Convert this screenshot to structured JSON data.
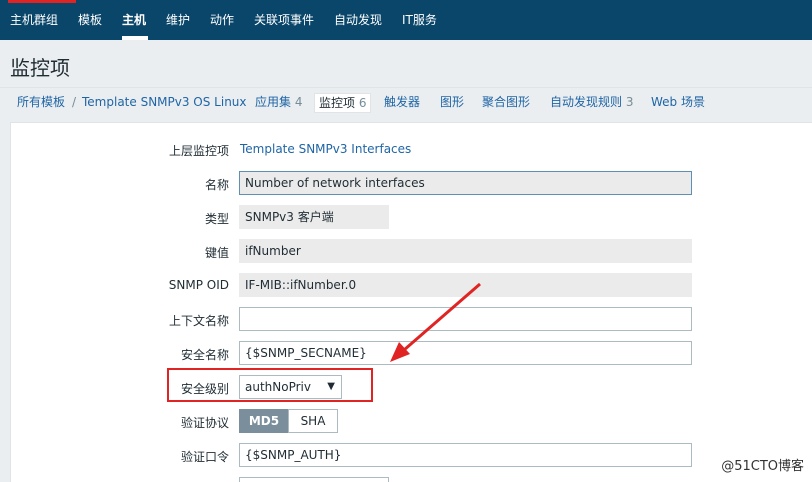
{
  "top_nav": [
    "主机群组",
    "模板",
    "主机",
    "维护",
    "动作",
    "关联项事件",
    "自动发现",
    "IT服务"
  ],
  "page_title": "监控项",
  "breadcrumb": {
    "all_templates": "所有模板",
    "separator": "/",
    "template": "Template SNMPv3 OS Linux",
    "tabs": [
      {
        "label": "应用集",
        "count": "4"
      },
      {
        "label": "监控项",
        "count": "6"
      },
      {
        "label": "触发器",
        "count": ""
      },
      {
        "label": "图形",
        "count": ""
      },
      {
        "label": "聚合图形",
        "count": ""
      },
      {
        "label": "自动发现规则",
        "count": "3"
      },
      {
        "label": "Web 场景",
        "count": ""
      }
    ]
  },
  "form": {
    "parent_label": "上层监控项",
    "parent_value": "Template SNMPv3 Interfaces",
    "name_label": "名称",
    "name_value": "Number of network interfaces",
    "type_label": "类型",
    "type_value": "SNMPv3 客户端",
    "key_label": "键值",
    "key_value": "ifNumber",
    "oid_label": "SNMP OID",
    "oid_value": "IF-MIB::ifNumber.0",
    "context_label": "上下文名称",
    "context_value": "",
    "secname_label": "安全名称",
    "secname_value": "{$SNMP_SECNAME}",
    "seclevel_label": "安全级别",
    "seclevel_value": "authNoPriv",
    "authproto_label": "验证协议",
    "authproto_options": [
      "MD5",
      "SHA"
    ],
    "authproto_selected": "MD5",
    "authpass_label": "验证口令",
    "authpass_value": "{$SNMP_AUTH}"
  },
  "watermark": "@51CTO博客",
  "colors": {
    "nav_bg": "#0a466a",
    "link": "#1f65a6",
    "highlight": "#e02323"
  }
}
